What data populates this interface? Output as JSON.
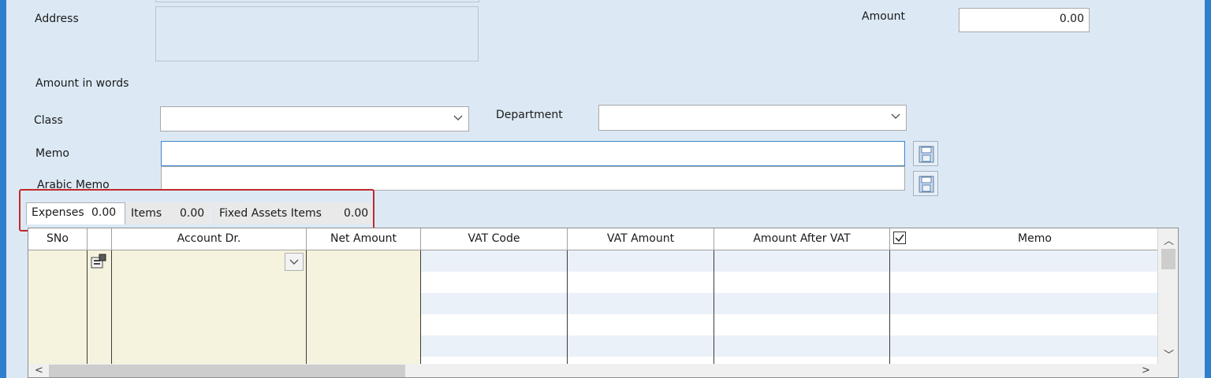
{
  "form": {
    "address_label": "Address",
    "amount_label": "Amount",
    "amount_value": "0.00",
    "amount_in_words_label": "Amount in words",
    "class_label": "Class",
    "department_label": "Department",
    "memo_label": "Memo",
    "arabic_memo_label": "Arabic Memo"
  },
  "tabs": [
    {
      "label": "Expenses",
      "value": "0.00",
      "active": true
    },
    {
      "label": "Items",
      "value": "0.00",
      "active": false
    },
    {
      "label": "Fixed Assets Items",
      "value": "0.00",
      "active": false
    }
  ],
  "grid": {
    "columns": [
      "SNo",
      "",
      "Account Dr.",
      "Net Amount",
      "VAT Code",
      "VAT Amount",
      "Amount After VAT",
      "",
      "Memo"
    ],
    "checkbox_checked": true
  },
  "colors": {
    "window_frame": "#2f7fd0",
    "background": "#dce9f5",
    "highlight": "#c0282b",
    "beige_column": "#f5f2dd"
  },
  "icons": [
    "chevron-down-icon",
    "save-icon",
    "properties-icon",
    "checkbox-icon",
    "scroll-up-icon",
    "scroll-down-icon",
    "scroll-left-icon",
    "scroll-right-icon"
  ]
}
